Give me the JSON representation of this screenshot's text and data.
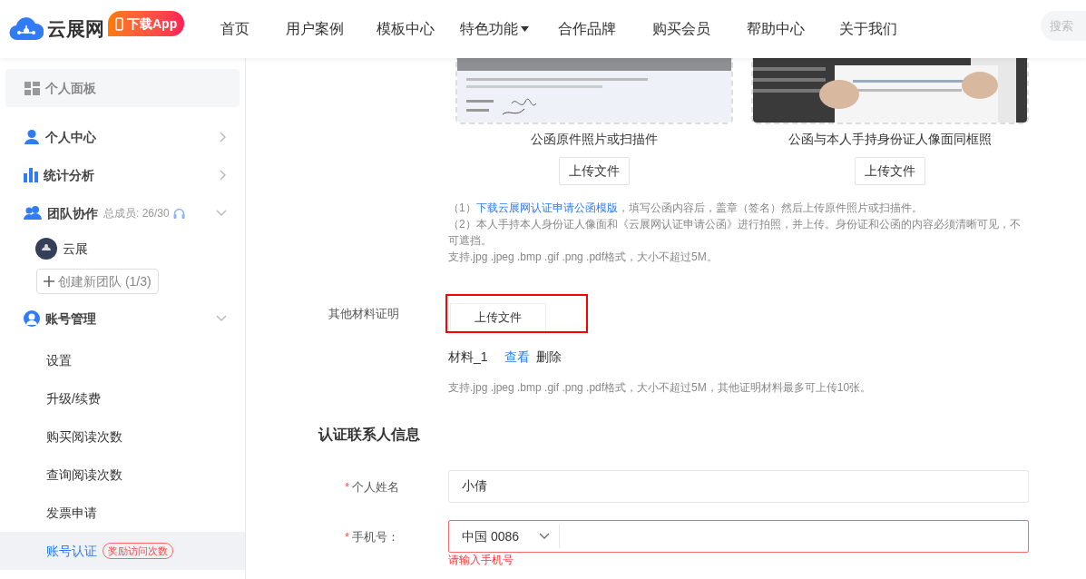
{
  "header": {
    "logo": "云展网",
    "app_badge": "下载App",
    "nav": [
      {
        "label": "首页",
        "dropdown": false
      },
      {
        "label": "用户案例",
        "dropdown": false
      },
      {
        "label": "模板中心",
        "dropdown": false
      },
      {
        "label": "特色功能",
        "dropdown": true
      },
      {
        "label": "合作品牌",
        "dropdown": false
      },
      {
        "label": "购买会员",
        "dropdown": false
      },
      {
        "label": "帮助中心",
        "dropdown": false
      },
      {
        "label": "关于我们",
        "dropdown": false
      }
    ],
    "search": {
      "placeholder": "搜索"
    }
  },
  "sidebar": {
    "panel": "个人面板",
    "sections": [
      {
        "label": "个人中心",
        "expanded": false
      },
      {
        "label": "统计分析",
        "expanded": false
      },
      {
        "label": "团队协作",
        "note": "总成员: 26/30",
        "expanded": true,
        "teams": [
          {
            "name": "云展"
          }
        ],
        "create_button": "创建新团队 (1/3)"
      },
      {
        "label": "账号管理",
        "expanded": true,
        "children": [
          {
            "label": "设置",
            "selected": false
          },
          {
            "label": "升级/续费",
            "selected": false
          },
          {
            "label": "购买阅读次数",
            "selected": false
          },
          {
            "label": "查询阅读次数",
            "selected": false
          },
          {
            "label": "发票申请",
            "selected": false
          },
          {
            "label": "账号认证",
            "selected": true,
            "badge": "奖励访问次数"
          }
        ]
      }
    ]
  },
  "main": {
    "upload_cards": [
      {
        "caption": "公函原件照片或扫描件",
        "button": "上传文件"
      },
      {
        "caption": "公函与本人手持身份证人像面同框照",
        "button": "上传文件"
      }
    ],
    "notes": [
      {
        "prefix": "（1）",
        "link": "下载云展网认证申请公函模版",
        "text": "，填写公函内容后，盖章（签名）然后上传原件照片或扫描件。"
      },
      {
        "text": "（2）本人手持本人身份证人像面和《云展网认证申请公函》进行拍照，并上传。身份证和公函的内容必须清晰可见，不可遮挡。"
      },
      {
        "text": "支持.jpg .jpeg .bmp .gif .png .pdf格式，大小不超过5M。"
      }
    ],
    "other_materials": {
      "label": "其他材料证明",
      "button": "上传文件",
      "highlighted": true,
      "files": [
        {
          "name": "材料_1",
          "view": "查看",
          "delete": "删除"
        }
      ],
      "hint": "支持.jpg .jpeg .bmp .gif .png .pdf格式，大小不超过5M，其他证明材料最多可上传10张。"
    },
    "contact": {
      "title": "认证联系人信息",
      "fields": [
        {
          "kind": "text",
          "label": "个人姓名",
          "required_mark": "*",
          "value": "小倩"
        },
        {
          "kind": "phone",
          "label": "手机号：",
          "required_mark": "*",
          "country": "中国 0086",
          "error": "请输入手机号"
        }
      ]
    }
  }
}
